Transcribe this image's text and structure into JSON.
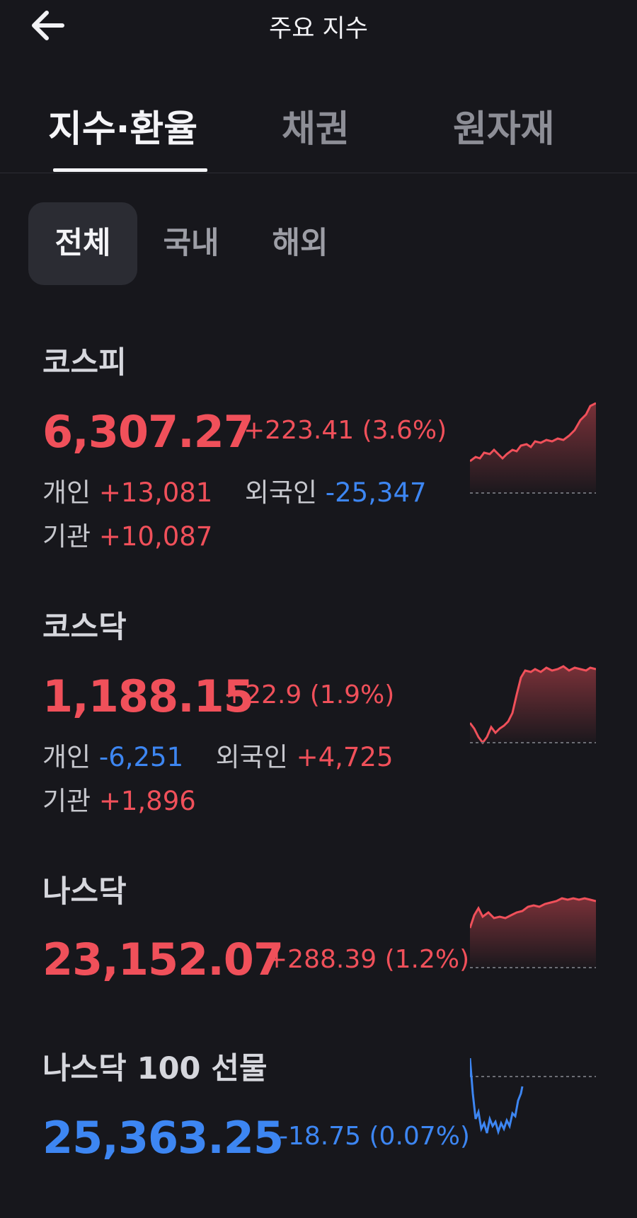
{
  "header": {
    "title": "주요 지수",
    "back_icon": "arrow-left-icon"
  },
  "tabs": [
    {
      "label": "지수·환율",
      "active": true
    },
    {
      "label": "채권",
      "active": false
    },
    {
      "label": "원자재",
      "active": false
    }
  ],
  "segments": [
    {
      "label": "전체",
      "active": true
    },
    {
      "label": "국내",
      "active": false
    },
    {
      "label": "해외",
      "active": false
    }
  ],
  "colors": {
    "up": "#f0505a",
    "down": "#3d86f2",
    "background": "#17171c"
  },
  "indices": [
    {
      "name": "코스피",
      "price": "6,307.27",
      "change": "+223.41 (3.6%)",
      "direction": "up",
      "flows": {
        "individual_label": "개인",
        "individual": "+13,081",
        "foreign_label": "외국인",
        "foreign": "-25,347",
        "institution_label": "기관",
        "institution": "+10,087"
      }
    },
    {
      "name": "코스닥",
      "price": "1,188.15",
      "change": "+22.9 (1.9%)",
      "direction": "up",
      "flows": {
        "individual_label": "개인",
        "individual": "-6,251",
        "foreign_label": "외국인",
        "foreign": "+4,725",
        "institution_label": "기관",
        "institution": "+1,896"
      }
    },
    {
      "name": "나스닥",
      "price": "23,152.07",
      "change": "+288.39 (1.2%)",
      "direction": "up"
    },
    {
      "name": "나스닥 100 선물",
      "price": "25,363.25",
      "change": "-18.75 (0.07%)",
      "direction": "down"
    }
  ]
}
